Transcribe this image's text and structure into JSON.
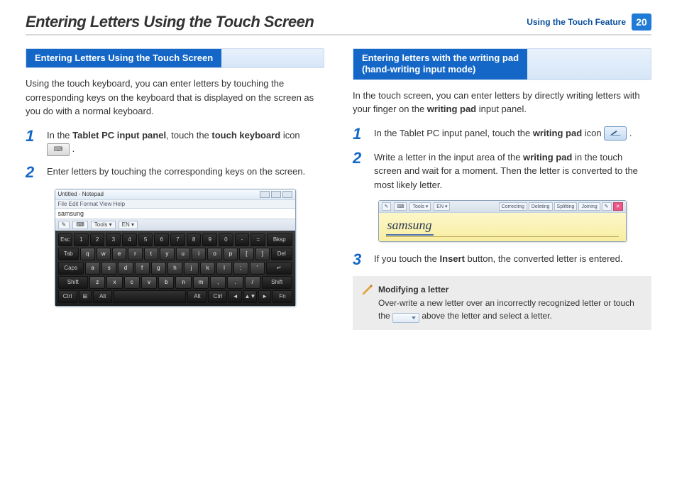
{
  "header": {
    "title": "Entering Letters Using the Touch Screen",
    "chapter": "Using the Touch Feature",
    "page_number": "20"
  },
  "left": {
    "section_title": "Entering Letters Using the Touch Screen",
    "intro": "Using the touch keyboard, you can enter letters by touching the corresponding keys on the keyboard that is displayed on the screen as you do with a normal keyboard.",
    "step1": {
      "num": "1",
      "pre": "In the ",
      "b1": "Tablet PC input panel",
      "mid": ", touch the ",
      "b2": "touch keyboard",
      "post": " icon ",
      "end": " ."
    },
    "step2": {
      "num": "2",
      "text": "Enter letters by touching the corresponding keys on the screen."
    },
    "keyboard": {
      "window_title": "Untitled - Notepad",
      "menu": "File   Edit   Format   View   Help",
      "typed_text": "samsung",
      "toolbar": {
        "tools": "Tools ▾",
        "lang": "EN ▾"
      },
      "rows": [
        [
          "Esc",
          "!\n1",
          "@\n2",
          "#\n3",
          "$\n4",
          "%\n5",
          "^\n6",
          "&\n7",
          "*\n8",
          "(\n9",
          ")\n0",
          "-",
          "=",
          "Bksp"
        ],
        [
          "Tab",
          "q",
          "w",
          "e",
          "r",
          "t",
          "y",
          "u",
          "i",
          "o",
          "p",
          "[",
          "]",
          "Del"
        ],
        [
          "Caps",
          "a",
          "s",
          "d",
          "f",
          "g",
          "h",
          "j",
          "k",
          "l",
          ";",
          "'",
          "↵"
        ],
        [
          "Shift",
          "z",
          "x",
          "c",
          "v",
          "b",
          "n",
          "m",
          ",",
          ".",
          "/",
          "Shift"
        ],
        [
          "Ctrl",
          "⊞",
          "Alt",
          "",
          "Alt",
          "Ctrl",
          "◄",
          "▲▼",
          "►",
          "Fn"
        ]
      ]
    }
  },
  "right": {
    "section_title": "Entering letters with the writing pad\n(hand-writing input mode)",
    "intro_pre": "In the touch screen, you can enter letters by directly writing letters with your finger on the ",
    "intro_b": "writing pad",
    "intro_post": " input panel.",
    "step1": {
      "num": "1",
      "pre": "In the Tablet PC input panel, touch the ",
      "b": "writing pad",
      "mid": " icon ",
      "end": " ."
    },
    "step2": {
      "num": "2",
      "pre": "Write a letter in the input area of the ",
      "b": "writing pad",
      "post": " in the touch screen and wait for a moment. Then the letter is converted to the most likely letter."
    },
    "writing_pad": {
      "toolbar": {
        "tools": "Tools ▾",
        "lang": "EN ▾",
        "actions": [
          "Correcting",
          "Deleting",
          "Splitting",
          "Joining"
        ]
      },
      "handwriting": "samsung"
    },
    "step3": {
      "num": "3",
      "pre": "If you touch the ",
      "b": "Insert",
      "post": " button, the converted letter is entered."
    },
    "note": {
      "title": "Modifying a letter",
      "line_pre": "Over-write a new letter over an incorrectly recognized letter or touch the ",
      "line_post": " above the letter and select a letter."
    }
  }
}
